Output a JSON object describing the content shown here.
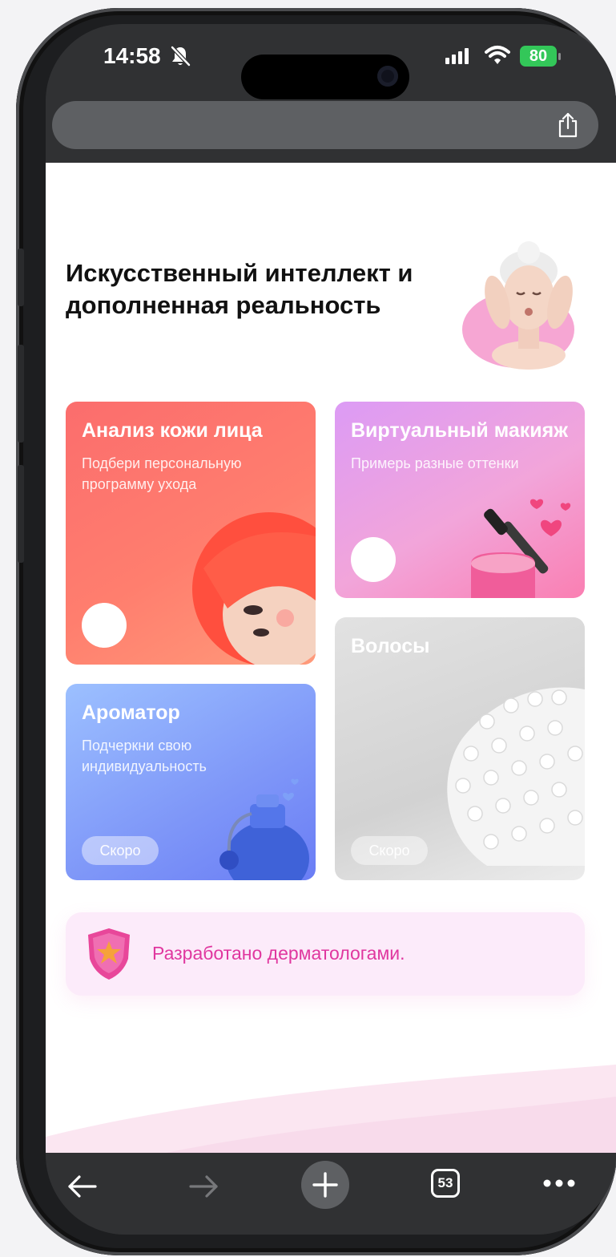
{
  "status_bar": {
    "time": "14:58",
    "battery": "80"
  },
  "page": {
    "title": "Искусственный интеллект и дополненная реальность"
  },
  "cards": [
    {
      "title": "Анализ кожи лица",
      "subtitle": "Подбери персональную программу ухода"
    },
    {
      "title": "Виртуальный макияж",
      "subtitle": "Примерь разные оттенки"
    },
    {
      "title": "Ароматор",
      "subtitle": "Подчеркни свою индивидуальность",
      "badge": "Скоро"
    },
    {
      "title": "Волосы",
      "badge": "Скоро"
    }
  ],
  "banner": {
    "text": "Разработано дерматологами."
  },
  "toolbar": {
    "tabs_count": "53"
  },
  "colors": {
    "accent_pink": "#e0379f",
    "battery_green": "#33c759",
    "card_skin": "#ff6f6f",
    "card_makeup": "#e89cf2",
    "card_aroma": "#7c93f7",
    "card_hair": "#d6d6d6"
  },
  "icons": [
    "bell-slash-icon",
    "cellular-icon",
    "wifi-icon",
    "battery-icon",
    "share-icon",
    "back-icon",
    "forward-icon",
    "plus-icon",
    "tabs-icon",
    "more-icon",
    "shield-star-icon"
  ]
}
